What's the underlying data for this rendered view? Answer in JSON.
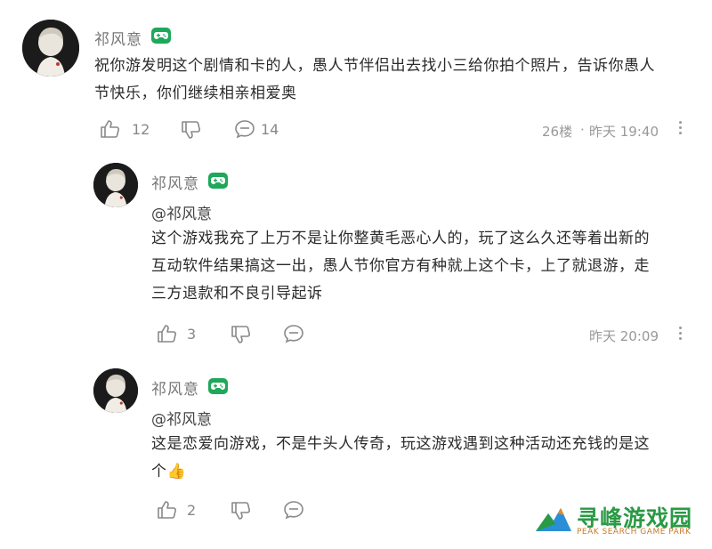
{
  "comments": [
    {
      "username": "祁风意",
      "mention": "",
      "text_lines": [
        "祝你游发明这个剧情和卡的人，愚人节伴侣出去找小三给你拍个照片，告诉你愚人",
        "节快乐，你们继续相亲相爱奥"
      ],
      "likes": "12",
      "replies": "14",
      "floor": "26楼",
      "time": "昨天 19:40"
    },
    {
      "username": "祁风意",
      "mention": "@祁风意",
      "text_lines": [
        "这个游戏我充了上万不是让你整黄毛恶心人的，玩了这么久还等着出新的",
        "互动软件结果搞这一出，愚人节你官方有种就上这个卡，上了就退游，走",
        "三方退款和不良引导起诉"
      ],
      "likes": "3",
      "time": "昨天 20:09"
    },
    {
      "username": "祁风意",
      "mention": "@祁风意",
      "text_lines": [
        "这是恋爱向游戏，不是牛头人传奇，玩这游戏遇到这种活动还充钱的是这",
        "个👍"
      ],
      "likes": "2"
    }
  ],
  "watermark": {
    "title": "寻峰游戏园",
    "subtitle": "PEAK SEARCH GAME PARK"
  },
  "colors": {
    "badge": "#1ea85a",
    "watermark_green": "#2a9a45",
    "watermark_orange": "#c87a2a"
  }
}
